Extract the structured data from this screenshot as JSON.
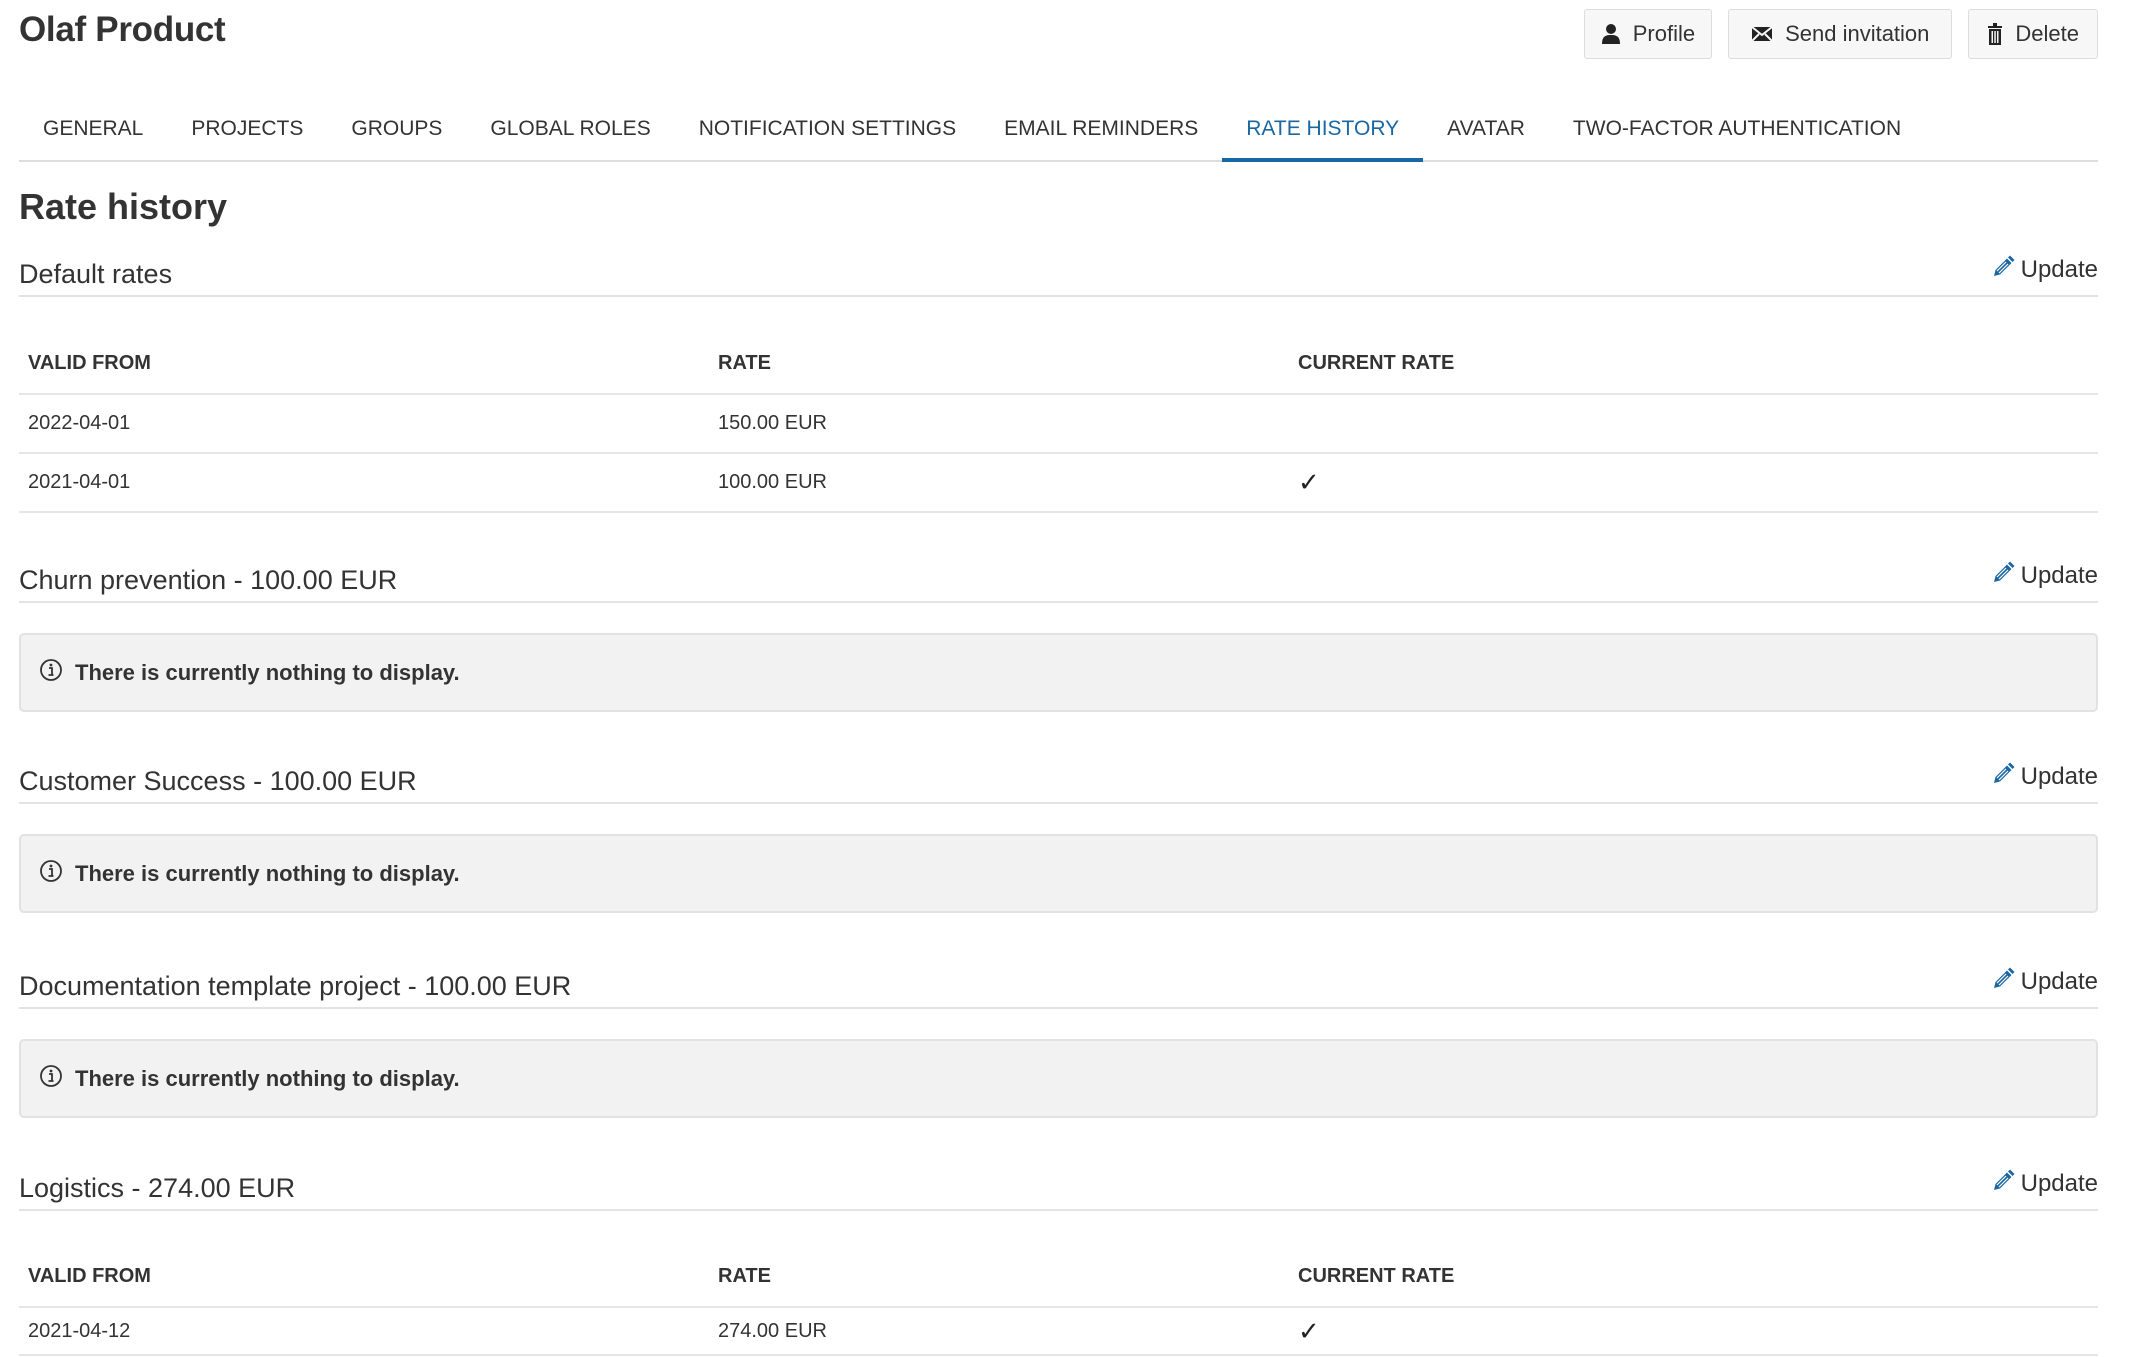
{
  "header": {
    "title": "Olaf Product",
    "buttons": [
      {
        "label": "Profile",
        "icon": "user-icon"
      },
      {
        "label": "Send invitation",
        "icon": "envelope-icon"
      },
      {
        "label": "Delete",
        "icon": "trash-icon"
      }
    ]
  },
  "tabs": [
    {
      "label": "GENERAL",
      "active": false
    },
    {
      "label": "PROJECTS",
      "active": false
    },
    {
      "label": "GROUPS",
      "active": false
    },
    {
      "label": "GLOBAL ROLES",
      "active": false
    },
    {
      "label": "NOTIFICATION SETTINGS",
      "active": false
    },
    {
      "label": "EMAIL REMINDERS",
      "active": false
    },
    {
      "label": "RATE HISTORY",
      "active": true
    },
    {
      "label": "AVATAR",
      "active": false
    },
    {
      "label": "TWO-FACTOR AUTHENTICATION",
      "active": false
    }
  ],
  "accent_color": "#1a67a3",
  "page_heading": "Rate history",
  "update_label": "Update",
  "empty_notice": "There is currently nothing to display.",
  "table_headers": [
    "VALID FROM",
    "RATE",
    "CURRENT RATE"
  ],
  "sections": [
    {
      "title": "Default rates",
      "rows": [
        {
          "valid_from": "2022-04-01",
          "rate": "150.00 EUR",
          "current": false
        },
        {
          "valid_from": "2021-04-01",
          "rate": "100.00 EUR",
          "current": true
        }
      ]
    },
    {
      "title": "Churn prevention - 100.00 EUR",
      "rows": []
    },
    {
      "title": "Customer Success - 100.00 EUR",
      "rows": []
    },
    {
      "title": "Documentation template project - 100.00 EUR",
      "rows": []
    },
    {
      "title": "Logistics - 274.00 EUR",
      "rows": [
        {
          "valid_from": "2021-04-12",
          "rate": "274.00 EUR",
          "current": true
        }
      ]
    }
  ],
  "current_mark": "✓"
}
